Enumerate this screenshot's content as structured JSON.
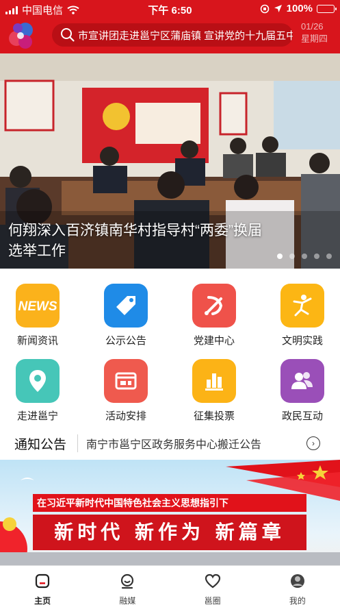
{
  "status_bar": {
    "carrier": "中国电信",
    "time": "下午 6:50",
    "battery": "100%"
  },
  "header": {
    "search_text": "市宣讲团走进邕宁区蒲庙镇 宣讲党的十九届五中全",
    "date": "01/26",
    "date_sub": "星期四"
  },
  "banner": {
    "caption": "何翔深入百济镇南华村指导村“两委”换届选举工作",
    "slide_count": 5,
    "active_slide": 1
  },
  "grid": [
    {
      "label": "新闻资讯",
      "icon": "news-icon",
      "color": "#fbb21b"
    },
    {
      "label": "公示公告",
      "icon": "tag-icon",
      "color": "#1f8be7"
    },
    {
      "label": "党建中心",
      "icon": "party-emblem-icon",
      "color": "#ef524a"
    },
    {
      "label": "文明实践",
      "icon": "dancer-icon",
      "color": "#fcb614"
    },
    {
      "label": "走进邕宁",
      "icon": "map-pin-icon",
      "color": "#46c6b8"
    },
    {
      "label": "活动安排",
      "icon": "schedule-icon",
      "color": "#ef5a4e"
    },
    {
      "label": "征集投票",
      "icon": "bar-chart-icon",
      "color": "#fcb316"
    },
    {
      "label": "政民互动",
      "icon": "users-icon",
      "color": "#9a4fb8"
    }
  ],
  "notice": {
    "title": "通知公告",
    "text": "南宁市邕宁区政务服务中心搬迁公告"
  },
  "promo": {
    "line1": "在习近平新时代中国特色社会主义思想指引下",
    "line2": "新时代  新作为  新篇章"
  },
  "tabs": [
    {
      "label": "主页",
      "icon": "home-icon",
      "active": true
    },
    {
      "label": "融媒",
      "icon": "media-icon",
      "active": false
    },
    {
      "label": "邕圈",
      "icon": "heart-icon",
      "active": false
    },
    {
      "label": "我的",
      "icon": "profile-icon",
      "active": false
    }
  ]
}
